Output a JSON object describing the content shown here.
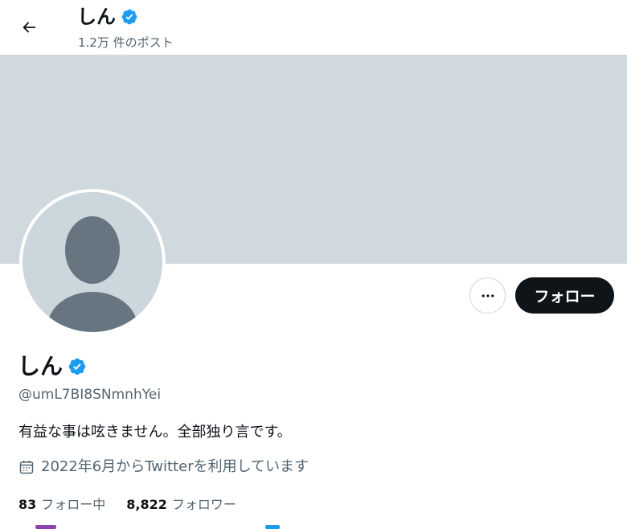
{
  "header": {
    "title": "しん",
    "post_count": "1.2万 件のポスト"
  },
  "profile": {
    "name": "しん",
    "handle": "@umL7BI8SNmnhYei",
    "bio": "有益な事は呟きません。全部独り言です。",
    "joined": "2022年6月からTwitterを利用しています",
    "following_count": "83",
    "following_label": "フォロー中",
    "followers_count": "8,822",
    "followers_label": "フォロワー"
  },
  "actions": {
    "follow_label": "フォロー"
  },
  "icons": [
    "arrow-left-icon",
    "verified-badge-icon",
    "more-icon",
    "calendar-icon",
    "default-avatar-icon"
  ],
  "colors": {
    "verified": "#1d9bf0",
    "banner": "#cfd9de",
    "avatar_bg": "#ccd6dd",
    "avatar_figure": "#66757f",
    "follow_button": "#0f1419",
    "secondary_text": "#536471"
  }
}
